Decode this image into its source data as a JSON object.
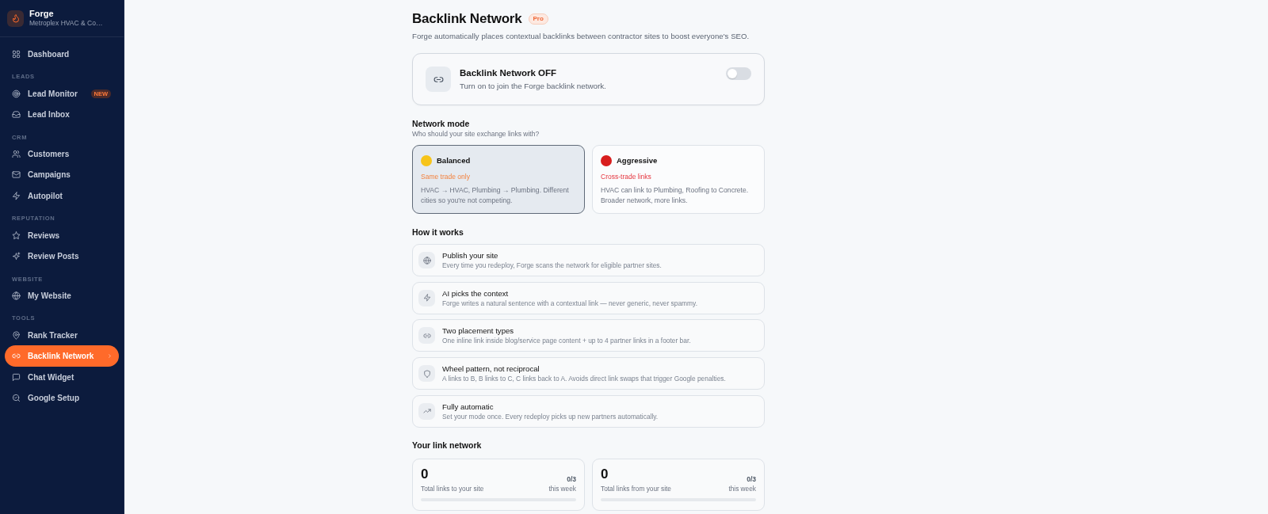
{
  "sidebar": {
    "brand": {
      "name": "Forge",
      "subtitle": "Metroplex HVAC & Co…"
    },
    "groups": [
      {
        "items": [
          {
            "label": "Dashboard",
            "selected": false
          }
        ]
      },
      {
        "heading": "LEADS",
        "items": [
          {
            "label": "Lead Monitor",
            "badge": "NEW",
            "selected": false
          },
          {
            "label": "Lead Inbox",
            "selected": false
          }
        ]
      },
      {
        "heading": "CRM",
        "items": [
          {
            "label": "Customers",
            "selected": false
          },
          {
            "label": "Campaigns",
            "selected": false
          },
          {
            "label": "Autopilot",
            "selected": false
          }
        ]
      },
      {
        "heading": "REPUTATION",
        "items": [
          {
            "label": "Reviews",
            "selected": false
          },
          {
            "label": "Review Posts",
            "selected": false
          }
        ]
      },
      {
        "heading": "WEBSITE",
        "items": [
          {
            "label": "My Website",
            "selected": false
          }
        ]
      },
      {
        "heading": "TOOLS",
        "items": [
          {
            "label": "Rank Tracker",
            "selected": false
          },
          {
            "label": "Backlink Network",
            "selected": true
          },
          {
            "label": "Chat Widget",
            "selected": false
          },
          {
            "label": "Google Setup",
            "selected": false
          }
        ]
      }
    ]
  },
  "header": {
    "title": "Backlink Network",
    "badge": "Pro",
    "subtitle": "Forge automatically places contextual backlinks between contractor sites to boost everyone's SEO."
  },
  "toggle_card": {
    "title": "Backlink Network OFF",
    "description": "Turn on to join the Forge backlink network.",
    "on": false
  },
  "network_mode": {
    "title": "Network mode",
    "subtitle": "Who should your site exchange links with?",
    "options": [
      {
        "name": "Balanced",
        "tagline": "Same trade only",
        "description": "HVAC → HVAC, Plumbing → Plumbing. Different cities so you're not competing.",
        "color": "#f7c41a",
        "selected": true
      },
      {
        "name": "Aggressive",
        "tagline": "Cross-trade links",
        "description": "HVAC can link to Plumbing, Roofing to Concrete. Broader network, more links.",
        "color": "#d81e1e",
        "selected": false
      }
    ]
  },
  "how_it_works": {
    "title": "How it works",
    "steps": [
      {
        "title": "Publish your site",
        "description": "Every time you redeploy, Forge scans the network for eligible partner sites."
      },
      {
        "title": "AI picks the context",
        "description": "Forge writes a natural sentence with a contextual link — never generic, never spammy."
      },
      {
        "title": "Two placement types",
        "description": "One inline link inside blog/service page content + up to 4 partner links in a footer bar."
      },
      {
        "title": "Wheel pattern, not reciprocal",
        "description": "A links to B, B links to C, C links back to A. Avoids direct link swaps that trigger Google penalties."
      },
      {
        "title": "Fully automatic",
        "description": "Set your mode once. Every redeploy picks up new partners automatically."
      }
    ]
  },
  "link_network": {
    "title": "Your link network",
    "stats": [
      {
        "value": "0",
        "label": "Total links to your site",
        "count": "0/3",
        "period": "this week",
        "level": 0
      },
      {
        "value": "0",
        "label": "Total links from your site",
        "count": "0/3",
        "period": "this week",
        "level": 0
      }
    ]
  }
}
